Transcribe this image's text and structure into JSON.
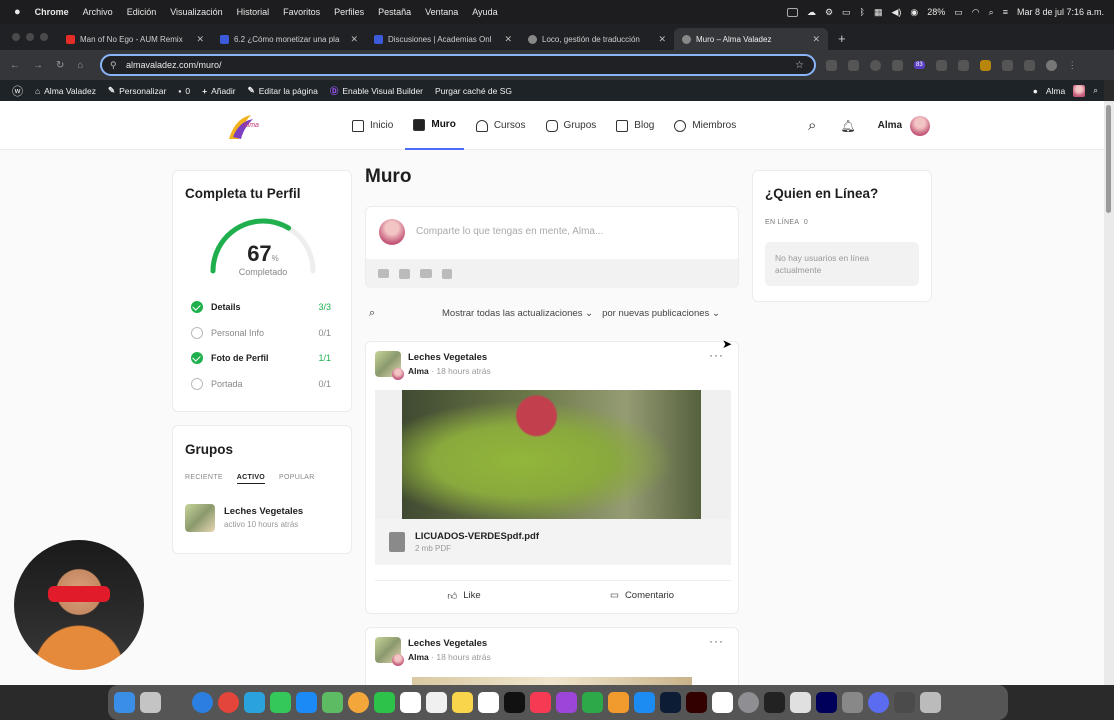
{
  "macbar": {
    "app": "Chrome",
    "menus": [
      "Archivo",
      "Edición",
      "Visualización",
      "Historial",
      "Favoritos",
      "Perfiles",
      "Pestaña",
      "Ventana",
      "Ayuda"
    ],
    "battery": "28%",
    "datetime": "Mar 8 de jul  7:16 a.m."
  },
  "browser": {
    "tabs": [
      {
        "label": "Man of No Ego - AUM Remix",
        "color": "#e52d27"
      },
      {
        "label": "6.2 ¿Cómo monetizar una pla",
        "color": "#3b5bdb"
      },
      {
        "label": "Discusiones | Academias Onl",
        "color": "#3b5bdb"
      },
      {
        "label": "Loco, gestión de traducción",
        "color": "#888888"
      },
      {
        "label": "Muro – Alma Valadez",
        "color": "#888888"
      }
    ],
    "url": "almavaladez.com/muro/",
    "badge": "83"
  },
  "wpbar": {
    "site": "Alma Valadez",
    "customize": "Personalizar",
    "comments": "0",
    "add": "Añadir",
    "edit": "Editar la página",
    "builder": "Enable Visual Builder",
    "purge": "Purgar caché de SG",
    "user": "Alma"
  },
  "header": {
    "logo_text": "Alma",
    "nav": [
      {
        "label": "Inicio",
        "icon": "home-icon"
      },
      {
        "label": "Muro",
        "icon": "wall-icon"
      },
      {
        "label": "Cursos",
        "icon": "courses-icon"
      },
      {
        "label": "Grupos",
        "icon": "groups-icon"
      },
      {
        "label": "Blog",
        "icon": "blog-icon"
      },
      {
        "label": "Miembros",
        "icon": "members-icon"
      }
    ],
    "user": "Alma"
  },
  "profile_card": {
    "title": "Completa tu Perfil",
    "percent": "67",
    "percent_sign": "%",
    "percent_value": 0.67,
    "status": "Completado",
    "items": [
      {
        "label": "Details",
        "value": "3/3",
        "done": true
      },
      {
        "label": "Personal Info",
        "value": "0/1",
        "done": false
      },
      {
        "label": "Foto de Perfil",
        "value": "1/1",
        "done": true
      },
      {
        "label": "Portada",
        "value": "0/1",
        "done": false
      }
    ]
  },
  "groups_card": {
    "title": "Grupos",
    "tabs": [
      "RECIENTE",
      "ACTIVO",
      "POPULAR"
    ],
    "group_name": "Leches Vegetales",
    "group_meta": "activo 10 hours atrás"
  },
  "main": {
    "title": "Muro",
    "composer_placeholder": "Comparte lo que tengas en mente, Alma...",
    "filter_show": "Mostrar todas las actualizaciones",
    "filter_order": "por nuevas publicaciones"
  },
  "posts": [
    {
      "group": "Leches Vegetales",
      "author": "Alma",
      "time": "· 18 hours atrás",
      "file_name": "LICUADOS-VERDESpdf.pdf",
      "file_meta": "2 mb  PDF",
      "like": "Like",
      "comment": "Comentario"
    },
    {
      "group": "Leches Vegetales",
      "author": "Alma",
      "time": "· 18 hours atrás"
    }
  ],
  "online_card": {
    "title": "¿Quien en Línea?",
    "label": "EN LÍNEA",
    "count": "0",
    "empty": "No hay usuarios en línea actualmente"
  },
  "colors": {
    "accent": "#4a6cf7",
    "success": "#1fb04d",
    "wpbar": "#1d2327"
  }
}
